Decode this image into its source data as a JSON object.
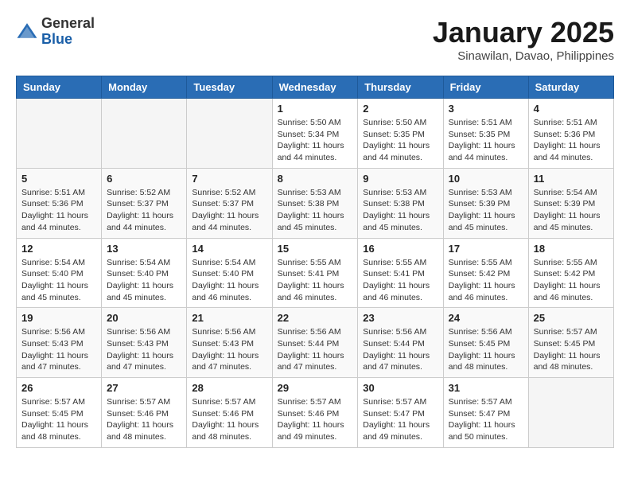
{
  "logo": {
    "general": "General",
    "blue": "Blue"
  },
  "header": {
    "month": "January 2025",
    "location": "Sinawilan, Davao, Philippines"
  },
  "weekdays": [
    "Sunday",
    "Monday",
    "Tuesday",
    "Wednesday",
    "Thursday",
    "Friday",
    "Saturday"
  ],
  "weeks": [
    [
      {
        "day": "",
        "info": ""
      },
      {
        "day": "",
        "info": ""
      },
      {
        "day": "",
        "info": ""
      },
      {
        "day": "1",
        "sunrise": "5:50 AM",
        "sunset": "5:34 PM",
        "daylight": "11 hours and 44 minutes."
      },
      {
        "day": "2",
        "sunrise": "5:50 AM",
        "sunset": "5:35 PM",
        "daylight": "11 hours and 44 minutes."
      },
      {
        "day": "3",
        "sunrise": "5:51 AM",
        "sunset": "5:35 PM",
        "daylight": "11 hours and 44 minutes."
      },
      {
        "day": "4",
        "sunrise": "5:51 AM",
        "sunset": "5:36 PM",
        "daylight": "11 hours and 44 minutes."
      }
    ],
    [
      {
        "day": "5",
        "sunrise": "5:51 AM",
        "sunset": "5:36 PM",
        "daylight": "11 hours and 44 minutes."
      },
      {
        "day": "6",
        "sunrise": "5:52 AM",
        "sunset": "5:37 PM",
        "daylight": "11 hours and 44 minutes."
      },
      {
        "day": "7",
        "sunrise": "5:52 AM",
        "sunset": "5:37 PM",
        "daylight": "11 hours and 44 minutes."
      },
      {
        "day": "8",
        "sunrise": "5:53 AM",
        "sunset": "5:38 PM",
        "daylight": "11 hours and 45 minutes."
      },
      {
        "day": "9",
        "sunrise": "5:53 AM",
        "sunset": "5:38 PM",
        "daylight": "11 hours and 45 minutes."
      },
      {
        "day": "10",
        "sunrise": "5:53 AM",
        "sunset": "5:39 PM",
        "daylight": "11 hours and 45 minutes."
      },
      {
        "day": "11",
        "sunrise": "5:54 AM",
        "sunset": "5:39 PM",
        "daylight": "11 hours and 45 minutes."
      }
    ],
    [
      {
        "day": "12",
        "sunrise": "5:54 AM",
        "sunset": "5:40 PM",
        "daylight": "11 hours and 45 minutes."
      },
      {
        "day": "13",
        "sunrise": "5:54 AM",
        "sunset": "5:40 PM",
        "daylight": "11 hours and 45 minutes."
      },
      {
        "day": "14",
        "sunrise": "5:54 AM",
        "sunset": "5:40 PM",
        "daylight": "11 hours and 46 minutes."
      },
      {
        "day": "15",
        "sunrise": "5:55 AM",
        "sunset": "5:41 PM",
        "daylight": "11 hours and 46 minutes."
      },
      {
        "day": "16",
        "sunrise": "5:55 AM",
        "sunset": "5:41 PM",
        "daylight": "11 hours and 46 minutes."
      },
      {
        "day": "17",
        "sunrise": "5:55 AM",
        "sunset": "5:42 PM",
        "daylight": "11 hours and 46 minutes."
      },
      {
        "day": "18",
        "sunrise": "5:55 AM",
        "sunset": "5:42 PM",
        "daylight": "11 hours and 46 minutes."
      }
    ],
    [
      {
        "day": "19",
        "sunrise": "5:56 AM",
        "sunset": "5:43 PM",
        "daylight": "11 hours and 47 minutes."
      },
      {
        "day": "20",
        "sunrise": "5:56 AM",
        "sunset": "5:43 PM",
        "daylight": "11 hours and 47 minutes."
      },
      {
        "day": "21",
        "sunrise": "5:56 AM",
        "sunset": "5:43 PM",
        "daylight": "11 hours and 47 minutes."
      },
      {
        "day": "22",
        "sunrise": "5:56 AM",
        "sunset": "5:44 PM",
        "daylight": "11 hours and 47 minutes."
      },
      {
        "day": "23",
        "sunrise": "5:56 AM",
        "sunset": "5:44 PM",
        "daylight": "11 hours and 47 minutes."
      },
      {
        "day": "24",
        "sunrise": "5:56 AM",
        "sunset": "5:45 PM",
        "daylight": "11 hours and 48 minutes."
      },
      {
        "day": "25",
        "sunrise": "5:57 AM",
        "sunset": "5:45 PM",
        "daylight": "11 hours and 48 minutes."
      }
    ],
    [
      {
        "day": "26",
        "sunrise": "5:57 AM",
        "sunset": "5:45 PM",
        "daylight": "11 hours and 48 minutes."
      },
      {
        "day": "27",
        "sunrise": "5:57 AM",
        "sunset": "5:46 PM",
        "daylight": "11 hours and 48 minutes."
      },
      {
        "day": "28",
        "sunrise": "5:57 AM",
        "sunset": "5:46 PM",
        "daylight": "11 hours and 48 minutes."
      },
      {
        "day": "29",
        "sunrise": "5:57 AM",
        "sunset": "5:46 PM",
        "daylight": "11 hours and 49 minutes."
      },
      {
        "day": "30",
        "sunrise": "5:57 AM",
        "sunset": "5:47 PM",
        "daylight": "11 hours and 49 minutes."
      },
      {
        "day": "31",
        "sunrise": "5:57 AM",
        "sunset": "5:47 PM",
        "daylight": "11 hours and 50 minutes."
      },
      {
        "day": "",
        "info": ""
      }
    ]
  ],
  "labels": {
    "sunrise": "Sunrise:",
    "sunset": "Sunset:",
    "daylight": "Daylight:"
  }
}
